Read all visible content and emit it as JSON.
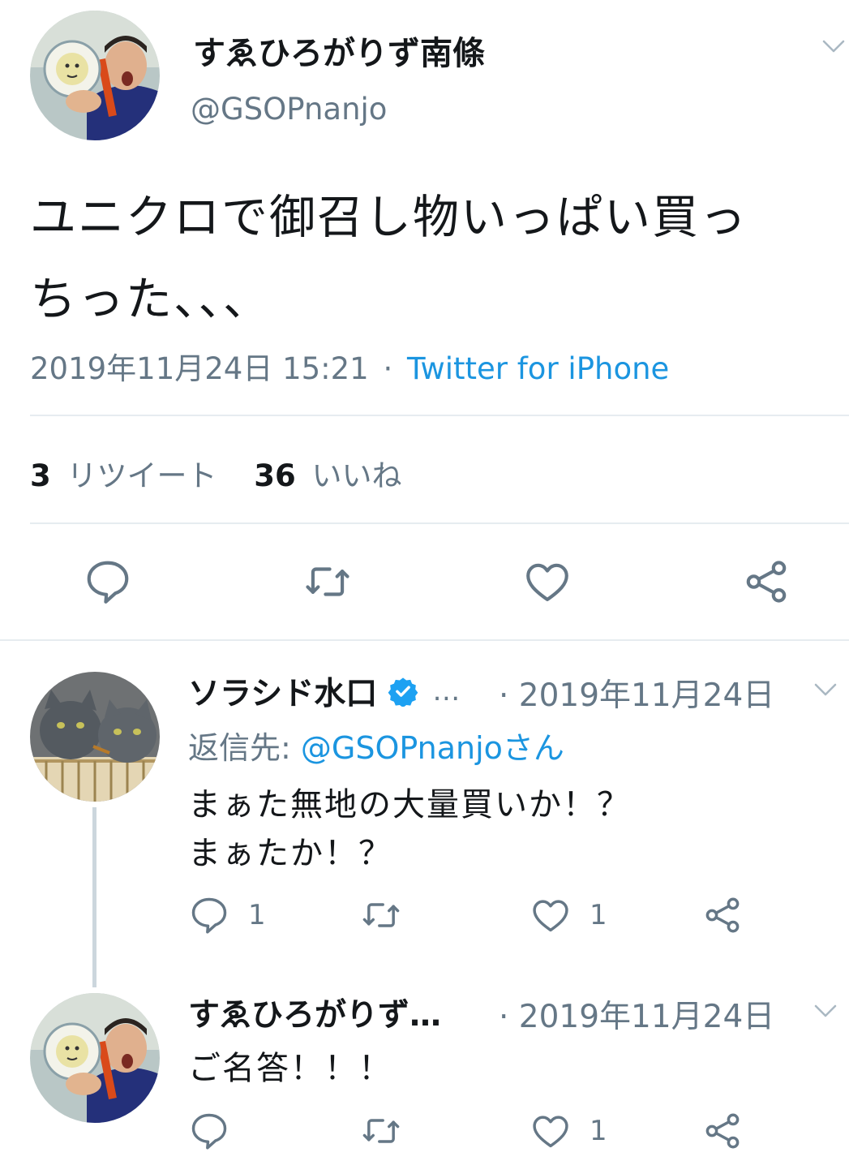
{
  "main_tweet": {
    "display_name": "すゑひろがりず南條",
    "handle": "@GSOPnanjo",
    "text_line1": "ユニクロで御召し物いっぱい買っ",
    "text_line2": "ちった、、、",
    "timestamp": "2019年11月24日 15:21",
    "separator": "·",
    "source": "Twitter for iPhone",
    "retweet_count": "3",
    "retweet_label": "リツイート",
    "like_count": "36",
    "like_label": "いいね",
    "icons": [
      "reply-icon",
      "retweet-icon",
      "like-icon",
      "share-icon"
    ]
  },
  "replies": [
    {
      "display_name": "ソラシド水口",
      "verified": true,
      "ellipsis": "…",
      "date": "· 2019年11月24日",
      "reply_to_prefix": "返信先: ",
      "reply_to_handle": "@GSOPnanjoさん",
      "text_line1": "まぁた無地の大量買いか！？",
      "text_line2": "まぁたか！？",
      "reply_count": "1",
      "like_count": "1"
    },
    {
      "display_name": "すゑひろがりず…",
      "date": "· 2019年11月24日",
      "text_line1": "ご名答！！！",
      "like_count": "1"
    }
  ],
  "colors": {
    "link": "#1b95e0",
    "muted": "#657786",
    "divider": "#e6ecf0",
    "verified": "#1da1f2"
  }
}
